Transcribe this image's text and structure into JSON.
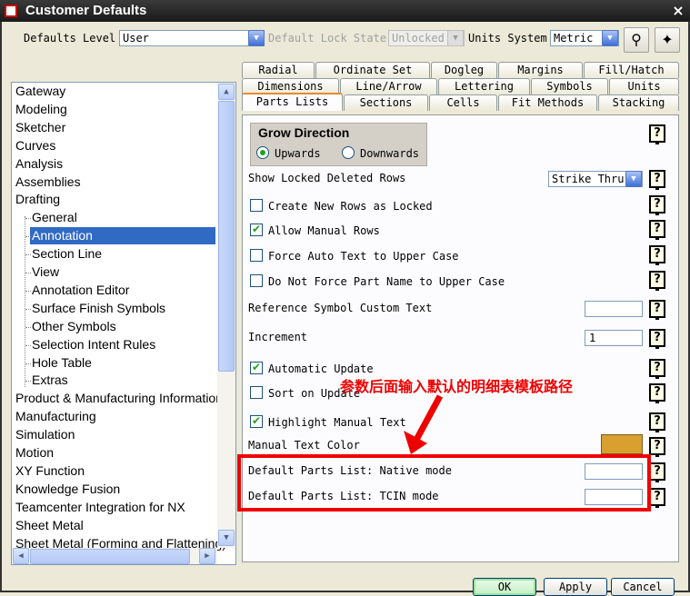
{
  "window": {
    "title": "Customer Defaults",
    "close": "×"
  },
  "toolbar": {
    "defaults_level_label": "Defaults Level",
    "defaults_level_value": "User",
    "lock_state_label": "Default Lock State",
    "lock_state_value": "Unlocked",
    "units_label": "Units System",
    "units_value": "Metric"
  },
  "tree": {
    "items": [
      "Gateway",
      "Modeling",
      "Sketcher",
      "Curves",
      "Analysis",
      "Assemblies",
      "Drafting",
      "General",
      "Annotation",
      "Section Line",
      "View",
      "Annotation Editor",
      "Surface Finish Symbols",
      "Other Symbols",
      "Selection Intent Rules",
      "Hole Table",
      "Extras",
      "Product & Manufacturing Information",
      "Manufacturing",
      "Simulation",
      "Motion",
      "XY Function",
      "Knowledge Fusion",
      "Teamcenter Integration for NX",
      "Sheet Metal",
      "Sheet Metal (Forming and Flattening)"
    ],
    "selected": "Annotation"
  },
  "tabs": {
    "row1": [
      "Radial",
      "Ordinate Set",
      "Dogleg",
      "Margins",
      "Fill/Hatch"
    ],
    "row2": [
      "Dimensions",
      "Line/Arrow",
      "Lettering",
      "Symbols",
      "Units"
    ],
    "row3": [
      "Parts Lists",
      "Sections",
      "Cells",
      "Fit Methods",
      "Stacking"
    ],
    "active": "Parts Lists"
  },
  "panel": {
    "grow_direction_title": "Grow Direction",
    "upwards": "Upwards",
    "downwards": "Downwards",
    "grow_direction_selected": "Upwards",
    "show_locked_label": "Show Locked Deleted Rows",
    "show_locked_value": "Strike Thru",
    "create_locked": "Create New Rows as Locked",
    "allow_manual": "Allow Manual Rows",
    "force_auto": "Force Auto Text to Upper Case",
    "do_not_force": "Do Not Force Part Name to Upper Case",
    "ref_symbol_label": "Reference Symbol Custom Text",
    "ref_symbol_value": "",
    "increment_label": "Increment",
    "increment_value": "1",
    "auto_update": "Automatic Update",
    "sort_on_update": "Sort on Update",
    "highlight_manual": "Highlight Manual Text",
    "manual_text_color_label": "Manual Text Color",
    "manual_text_color": "#d9a030",
    "native_mode_label": "Default Parts List: Native mode",
    "native_mode_value": "",
    "tcin_mode_label": "Default Parts List: TCIN mode",
    "tcin_mode_value": "",
    "help": "?",
    "checks": {
      "create_locked": false,
      "allow_manual": true,
      "force_auto": false,
      "do_not_force": false,
      "auto_update": true,
      "sort_on_update": false,
      "highlight_manual": true
    }
  },
  "annotation": {
    "text": "参数后面输入默认的明细表模板路径",
    "color": "#e00000"
  },
  "buttons": {
    "ok": "OK",
    "apply": "Apply",
    "cancel": "Cancel"
  }
}
